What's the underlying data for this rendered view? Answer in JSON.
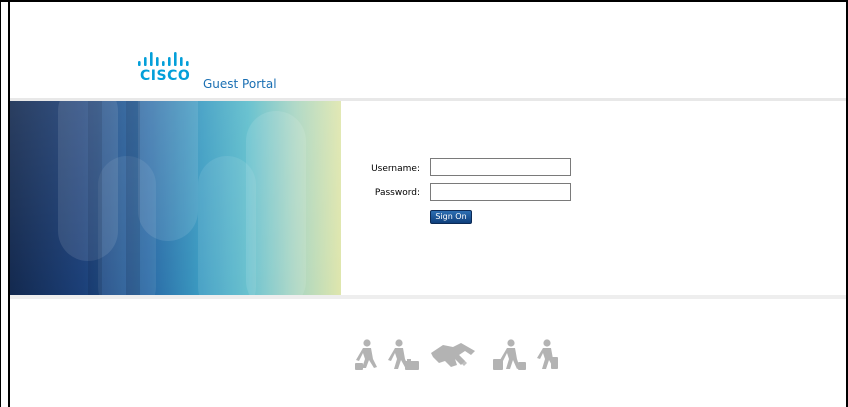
{
  "header": {
    "logo_text": "CISCO",
    "portal_title": "Guest Portal"
  },
  "login": {
    "username_label": "Username:",
    "username_value": "",
    "password_label": "Password:",
    "password_value": "",
    "signon_label": "Sign On"
  },
  "theme": {
    "accent": "#049fd9",
    "title_color": "#1a6fb3",
    "button_color": "#1b5597",
    "footer_icon_color": "#b3b3b3"
  },
  "footer": {
    "icons": [
      "walking-traveler-icon",
      "traveler-with-luggage-icon",
      "handshake-icon",
      "traveler-with-bags-icon",
      "walking-person-icon"
    ]
  }
}
